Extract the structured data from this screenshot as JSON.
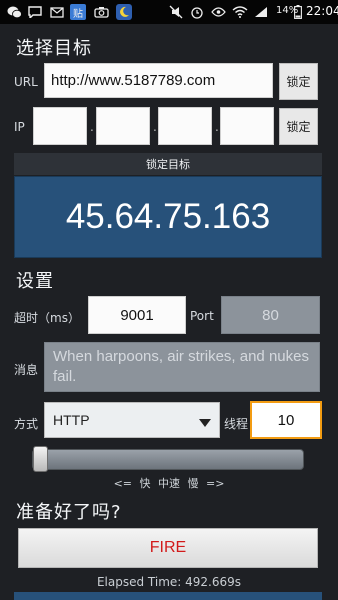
{
  "status_bar": {
    "time": "22:04",
    "battery": "14%",
    "left_icons": [
      "wechat-icon",
      "message-icon",
      "tie-app-icon",
      "camera-icon",
      "moon-icon"
    ],
    "right_icons": [
      "mute-icon",
      "alarm-icon",
      "eye-icon",
      "wifi-icon",
      "signal-icon",
      "battery-icon"
    ],
    "tie_label": "贴"
  },
  "target": {
    "heading": "选择目标",
    "url_label": "URL",
    "url_value": "http://www.5187789.com",
    "url_lock_button": "锁定",
    "ip_label": "IP",
    "ip_values": [
      "",
      "",
      "",
      ""
    ],
    "ip_lock_button": "锁定",
    "banner": "锁定目标",
    "locked_ip": "45.64.75.163"
  },
  "settings": {
    "heading": "设置",
    "timeout_label": "超时（ms）",
    "timeout_value": "9001",
    "port_label": "Port",
    "port_value": "80",
    "message_label": "消息",
    "message_value": "When harpoons, air strikes, and nukes fail.",
    "method_label": "方式",
    "method_value": "HTTP",
    "threads_label": "线程",
    "threads_value": "10",
    "speed_fraction": 0.0,
    "speed_scale": "<= 快   中速   慢 =>"
  },
  "ready": {
    "heading": "准备好了吗?",
    "fire_button": "FIRE",
    "elapsed": "Elapsed Time: 492.669s"
  },
  "colors": {
    "accent_blue": "#27517a",
    "fire_red": "#d21a1a",
    "focus_orange": "#f39c12"
  }
}
